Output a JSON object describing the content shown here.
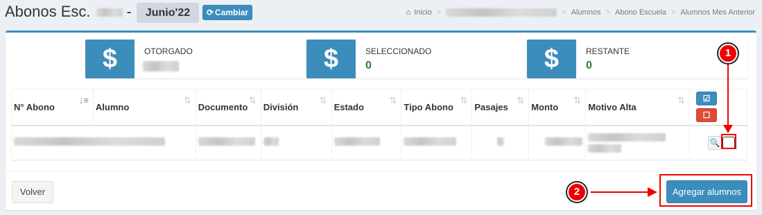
{
  "header": {
    "title_prefix": "Abonos Esc.",
    "title_dash": "-",
    "period": "Junio'22",
    "change_button": "Cambiar",
    "change_icon": "refresh-icon"
  },
  "breadcrumb": {
    "home_icon": "home-icon",
    "home": "Inicio",
    "separator": ">",
    "items": [
      "Alumnos",
      "Abono Escuela",
      "Alumnos Mes Anterior"
    ]
  },
  "stats": [
    {
      "label": "OTORGADO",
      "value": "",
      "icon": "$"
    },
    {
      "label": "SELECCIONADO",
      "value": "0",
      "icon": "$"
    },
    {
      "label": "RESTANTE",
      "value": "0",
      "icon": "$"
    }
  ],
  "table": {
    "headers": [
      "N° Abono",
      "Alumno",
      "Documento",
      "División",
      "Estado",
      "Tipo Abono",
      "Pasajes",
      "Monto",
      "Motivo Alta"
    ],
    "sort_icon": "⇅",
    "sort_active_icon": "↓≡",
    "select_all_icon": "☑",
    "deselect_all_icon": "☐",
    "row_zoom_icon": "🔍"
  },
  "footer": {
    "back_button": "Volver",
    "add_button": "Agregar alumnos"
  },
  "annotations": {
    "badge_1": "1",
    "badge_2": "2",
    "color": "#ee0000"
  },
  "colors": {
    "primary": "#3c8dbc",
    "danger": "#dd4b39",
    "success_text": "#2e7d32"
  }
}
